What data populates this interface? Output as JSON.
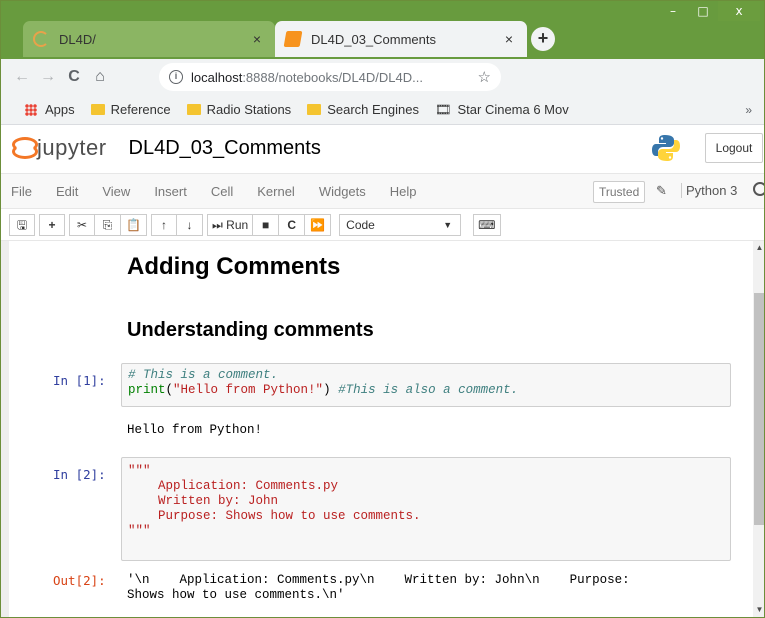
{
  "browser": {
    "tabs": [
      {
        "title": "DL4D/",
        "active": false
      },
      {
        "title": "DL4D_03_Comments",
        "active": true
      }
    ],
    "new_tab_glyph": "+",
    "window_controls": [
      "–",
      "□",
      "x"
    ],
    "nav": {
      "back": "←",
      "forward": "→",
      "reload": "C",
      "home": "⌂"
    },
    "address": {
      "host": "localhost",
      "path": ":8888/notebooks/DL4D/DL4D..."
    },
    "bookmarks": [
      {
        "label": "Apps",
        "icon": "apps-grid-icon"
      },
      {
        "label": "Reference",
        "icon": "folder-icon"
      },
      {
        "label": "Radio Stations",
        "icon": "folder-icon"
      },
      {
        "label": "Search Engines",
        "icon": "folder-icon"
      },
      {
        "label": "Star Cinema 6 Mov",
        "icon": "film-icon"
      }
    ],
    "bookmarks_more": "»",
    "colors": {
      "frame": "#689b3e",
      "inactive_tab": "#8bb563",
      "chrome": "#f1f3f4"
    }
  },
  "jupyter": {
    "logo_text": "jupyter",
    "notebook_title": "DL4D_03_Comments",
    "logout_label": "Logout",
    "menu": [
      "File",
      "Edit",
      "View",
      "Insert",
      "Cell",
      "Kernel",
      "Widgets",
      "Help"
    ],
    "trusted_label": "Trusted",
    "kernel_name": "Python 3",
    "toolbar": {
      "run_label": "Run",
      "cell_type": "Code"
    },
    "accent": "#f37726"
  },
  "notebook": {
    "heading1": "Adding Comments",
    "heading2": "Understanding comments",
    "cell1": {
      "prompt": "In [1]:",
      "line1_comment": "# This is a comment.",
      "line2_builtin": "print",
      "line2_open": "(",
      "line2_string": "\"Hello from Python!\"",
      "line2_close": ") ",
      "line2_comment": "#This is also a comment.",
      "output": "Hello from Python!"
    },
    "cell2": {
      "prompt": "In [2]:",
      "source": "\"\"\"\n    Application: Comments.py\n    Written by: John\n    Purpose: Shows how to use comments.\n\"\"\"",
      "out_prompt": "Out[2]:",
      "output": "'\\n    Application: Comments.py\\n    Written by: John\\n    Purpose:\nShows how to use comments.\\n'"
    }
  }
}
